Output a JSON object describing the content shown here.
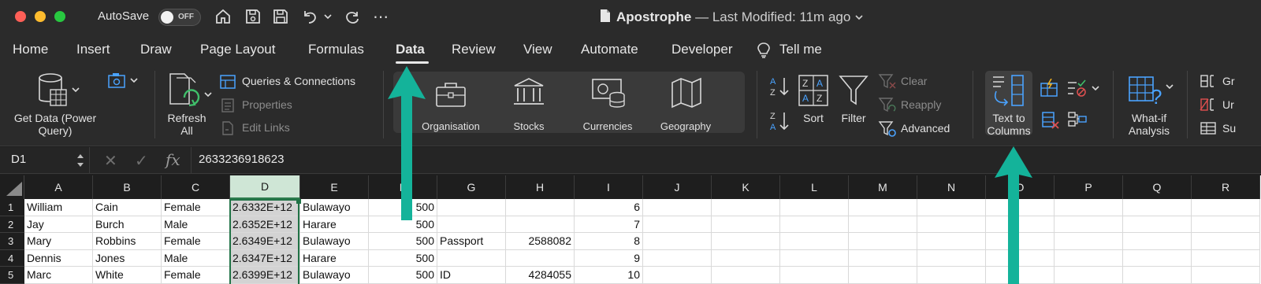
{
  "titlebar": {
    "autosave_label": "AutoSave",
    "autosave_state": "OFF",
    "document_title": "Apostrophe",
    "last_modified": "— Last Modified: 11m ago"
  },
  "tabs": [
    {
      "label": "Home"
    },
    {
      "label": "Insert"
    },
    {
      "label": "Draw"
    },
    {
      "label": "Page Layout"
    },
    {
      "label": "Formulas"
    },
    {
      "label": "Data",
      "active": true
    },
    {
      "label": "Review"
    },
    {
      "label": "View"
    },
    {
      "label": "Automate"
    },
    {
      "label": "Developer"
    },
    {
      "label": "Tell me"
    }
  ],
  "ribbon": {
    "get_data": "Get Data (Power",
    "get_data_2": "Query)",
    "refresh_all": "Refresh",
    "refresh_all_2": "All",
    "queries_connections": "Queries & Connections",
    "properties": "Properties",
    "edit_links": "Edit Links",
    "data_types": [
      "Organisation",
      "Stocks",
      "Currencies",
      "Geography"
    ],
    "sort": "Sort",
    "filter": "Filter",
    "clear": "Clear",
    "reapply": "Reapply",
    "advanced": "Advanced",
    "text_to_columns": "Text to",
    "text_to_columns_2": "Columns",
    "what_if": "What-if",
    "what_if_2": "Analysis",
    "group": "Gr",
    "ungroup": "Ur",
    "subtotal": "Su"
  },
  "formula_bar": {
    "name_box": "D1",
    "fx": "fx",
    "value": "2633236918623"
  },
  "grid": {
    "columns": [
      "A",
      "B",
      "C",
      "D",
      "E",
      "F",
      "G",
      "H",
      "I",
      "J",
      "K",
      "L",
      "M",
      "N",
      "O",
      "P",
      "Q",
      "R"
    ],
    "selected_column": "D",
    "rows": [
      {
        "n": "1",
        "A": "William",
        "B": "Cain",
        "C": "Female",
        "D": "2.6332E+12",
        "E": "Bulawayo",
        "F": "500",
        "G": "",
        "H": "",
        "I": "6"
      },
      {
        "n": "2",
        "A": "Jay",
        "B": "Burch",
        "C": "Male",
        "D": "2.6352E+12",
        "E": "Harare",
        "F": "500",
        "G": "",
        "H": "",
        "I": "7"
      },
      {
        "n": "3",
        "A": "Mary",
        "B": "Robbins",
        "C": "Female",
        "D": "2.6349E+12",
        "E": "Bulawayo",
        "F": "500",
        "G": "Passport",
        "H": "2588082",
        "I": "8"
      },
      {
        "n": "4",
        "A": "Dennis",
        "B": "Jones",
        "C": "Male",
        "D": "2.6347E+12",
        "E": "Harare",
        "F": "500",
        "G": "",
        "H": "",
        "I": "9"
      },
      {
        "n": "5",
        "A": "Marc",
        "B": "White",
        "C": "Female",
        "D": "2.6399E+12",
        "E": "Bulawayo",
        "F": "500",
        "G": "ID",
        "H": "4284055",
        "I": "10"
      }
    ]
  },
  "colors": {
    "arrow": "#14b39a",
    "selection": "#217346"
  }
}
